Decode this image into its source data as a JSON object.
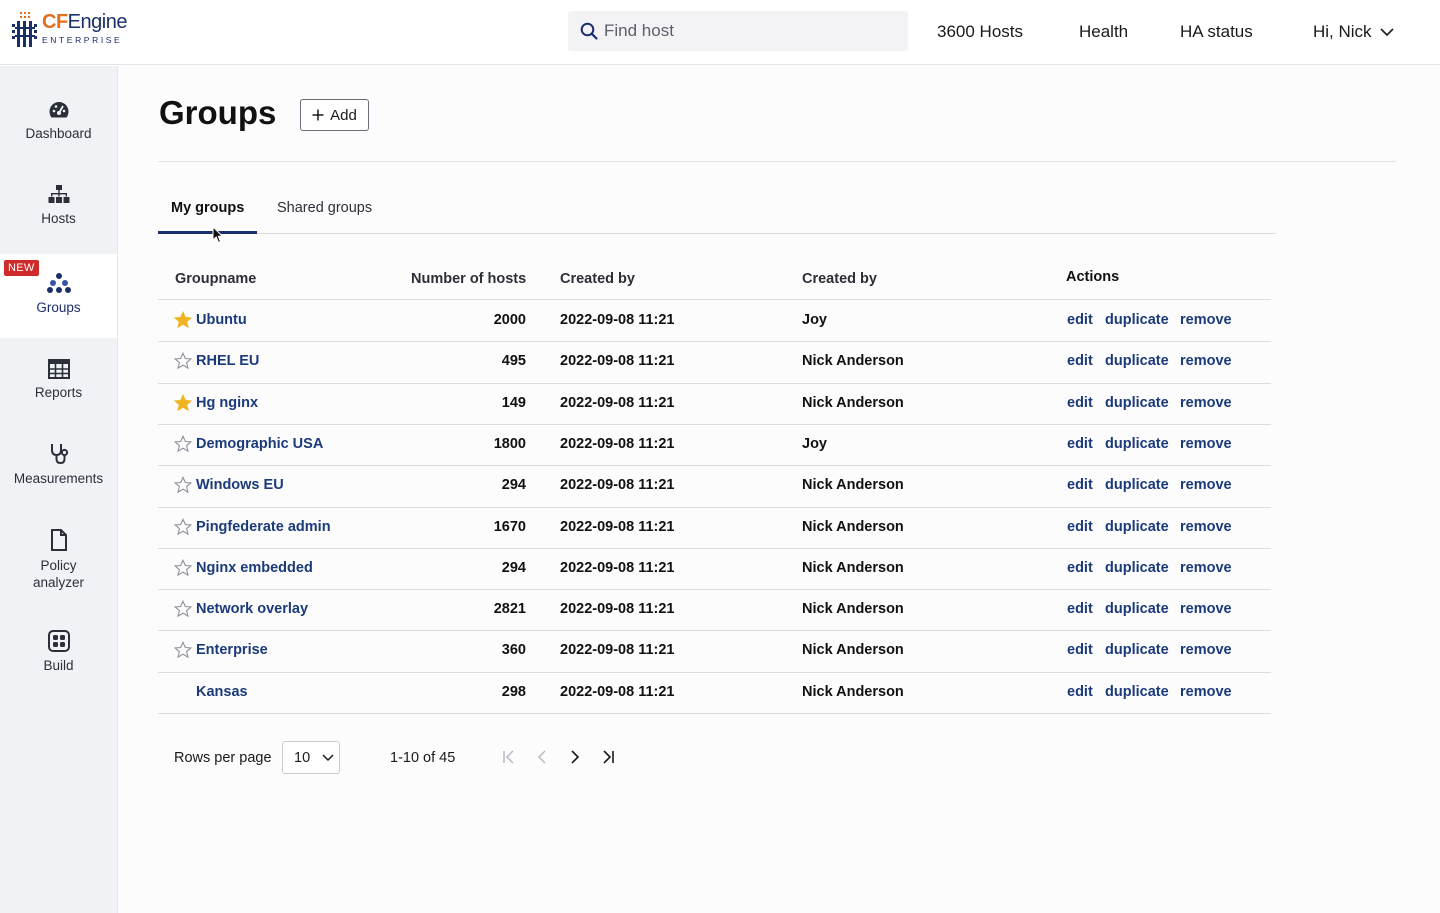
{
  "brand": {
    "name_cf": "CF",
    "name_rest": "Engine",
    "sub": "ENTERPRISE"
  },
  "topbar": {
    "search_placeholder": "Find host",
    "hosts_link": "3600 Hosts",
    "health_link": "Health",
    "ha_link": "HA status",
    "user_menu": "Hi, Nick"
  },
  "sidebar": {
    "items": [
      {
        "label": "Dashboard",
        "icon": "gauge-icon"
      },
      {
        "label": "Hosts",
        "icon": "hierarchy-icon"
      },
      {
        "label": "Groups",
        "icon": "groups-icon",
        "badge": "NEW",
        "active": true
      },
      {
        "label": "Reports",
        "icon": "table-icon"
      },
      {
        "label": "Measurements",
        "icon": "stethoscope-icon"
      },
      {
        "label_line1": "Policy",
        "label_line2": "analyzer",
        "icon": "document-icon"
      },
      {
        "label": "Build",
        "icon": "build-icon"
      }
    ]
  },
  "page": {
    "title": "Groups",
    "add_label": "Add"
  },
  "tabs": [
    {
      "label": "My groups",
      "active": true
    },
    {
      "label": "Shared groups",
      "active": false
    }
  ],
  "table": {
    "headers": {
      "groupname": "Groupname",
      "hosts": "Number of hosts",
      "created": "Created by",
      "creator": "Created by",
      "actions": "Actions"
    },
    "action_labels": {
      "edit": "edit",
      "duplicate": "duplicate",
      "remove": "remove"
    },
    "rows": [
      {
        "name": "Ubuntu",
        "hosts": "2000",
        "created": "2022-09-08 11:21",
        "creator": "Joy",
        "star": "filled"
      },
      {
        "name": "RHEL EU",
        "hosts": "495",
        "created": "2022-09-08 11:21",
        "creator": "Nick Anderson",
        "star": "empty"
      },
      {
        "name": "Hg nginx",
        "hosts": "149",
        "created": "2022-09-08 11:21",
        "creator": "Nick Anderson",
        "star": "filled"
      },
      {
        "name": "Demographic USA",
        "hosts": "1800",
        "created": "2022-09-08 11:21",
        "creator": "Joy",
        "star": "empty"
      },
      {
        "name": "Windows EU",
        "hosts": "294",
        "created": "2022-09-08 11:21",
        "creator": "Nick Anderson",
        "star": "empty"
      },
      {
        "name": "Pingfederate admin",
        "hosts": "1670",
        "created": "2022-09-08 11:21",
        "creator": "Nick Anderson",
        "star": "empty"
      },
      {
        "name": "Nginx embedded",
        "hosts": "294",
        "created": "2022-09-08 11:21",
        "creator": "Nick Anderson",
        "star": "empty"
      },
      {
        "name": "Network overlay",
        "hosts": "2821",
        "created": "2022-09-08 11:21",
        "creator": "Nick Anderson",
        "star": "empty"
      },
      {
        "name": "Enterprise",
        "hosts": "360",
        "created": "2022-09-08 11:21",
        "creator": "Nick Anderson",
        "star": "empty"
      },
      {
        "name": "Kansas",
        "hosts": "298",
        "created": "2022-09-08 11:21",
        "creator": "Nick Anderson",
        "star": "none"
      }
    ]
  },
  "pagination": {
    "rows_per_page_label": "Rows per page",
    "rows_per_page_value": "10",
    "range": "1-10 of 45"
  },
  "colors": {
    "brand_navy": "#1b2f6b",
    "brand_orange": "#e2711d",
    "link": "#1b3a7a",
    "star_gold": "#f0b323",
    "badge_red": "#cf2b2b"
  }
}
